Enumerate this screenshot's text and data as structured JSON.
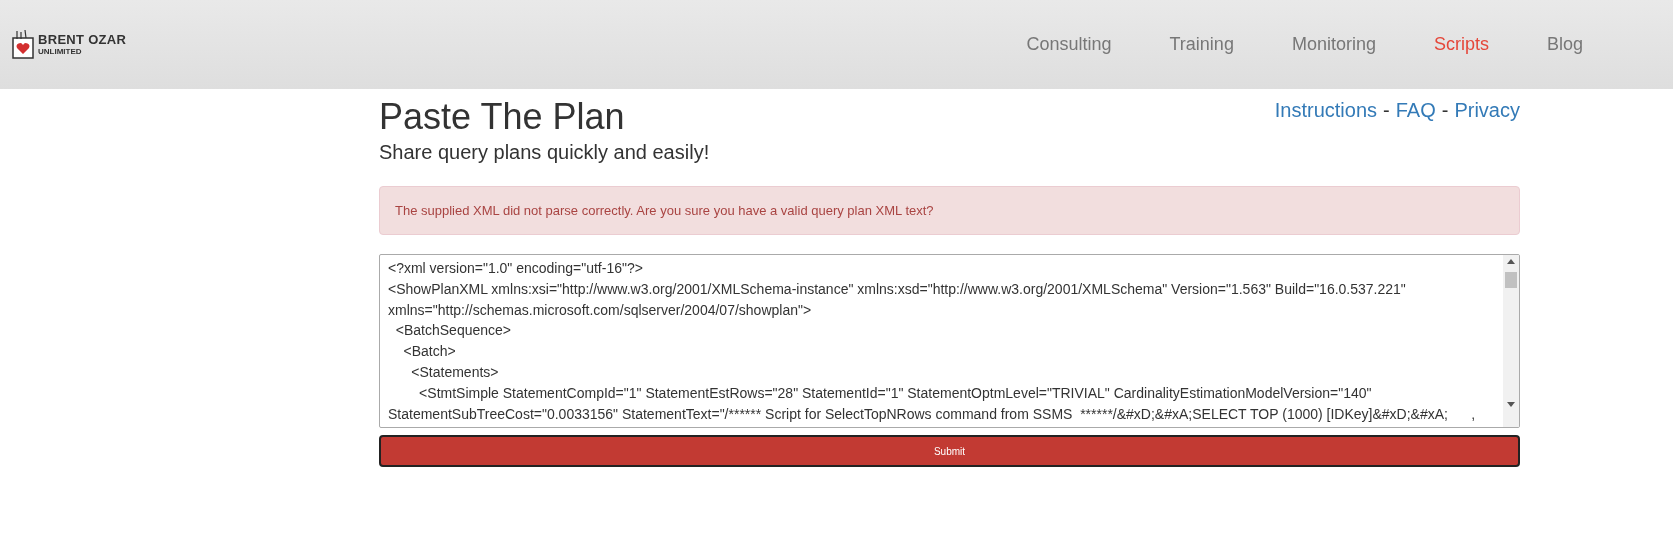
{
  "header": {
    "logo": {
      "name": "BRENT OZAR",
      "tagline": "UNLIMITED"
    },
    "nav": [
      {
        "label": "Consulting",
        "selected": false
      },
      {
        "label": "Training",
        "selected": false
      },
      {
        "label": "Monitoring",
        "selected": false
      },
      {
        "label": "Scripts",
        "selected": true
      },
      {
        "label": "Blog",
        "selected": false
      }
    ]
  },
  "title": "Paste The Plan",
  "subtitle": "Share query plans quickly and easily!",
  "links": [
    {
      "label": "Instructions"
    },
    {
      "label": "FAQ"
    },
    {
      "label": "Privacy"
    }
  ],
  "link_separator": "-",
  "alert": "The supplied XML did not parse correctly. Are you sure you have a valid query plan XML text?",
  "editor": {
    "lines": [
      "<?xml version=\"1.0\" encoding=\"utf-16\"?>",
      "<ShowPlanXML xmlns:xsi=\"http://www.w3.org/2001/XMLSchema-instance\" xmlns:xsd=\"http://www.w3.org/2001/XMLSchema\" Version=\"1.563\" Build=\"16.0.537.221\"",
      "xmlns=\"http://schemas.microsoft.com/sqlserver/2004/07/showplan\">",
      "  <BatchSequence>",
      "    <Batch>",
      "      <Statements>",
      "        <StmtSimple StatementCompId=\"1\" StatementEstRows=\"28\" StatementId=\"1\" StatementOptmLevel=\"TRIVIAL\" CardinalityEstimationModelVersion=\"140\"",
      "StatementSubTreeCost=\"0.0033156\" StatementText=\"/****** Script for SelectTopNRows command from SSMS  ******/&#xD;&#xA;SELECT TOP (1000) [IDKey]&#xD;&#xA;      ,"
    ]
  },
  "submit": "Submit"
}
